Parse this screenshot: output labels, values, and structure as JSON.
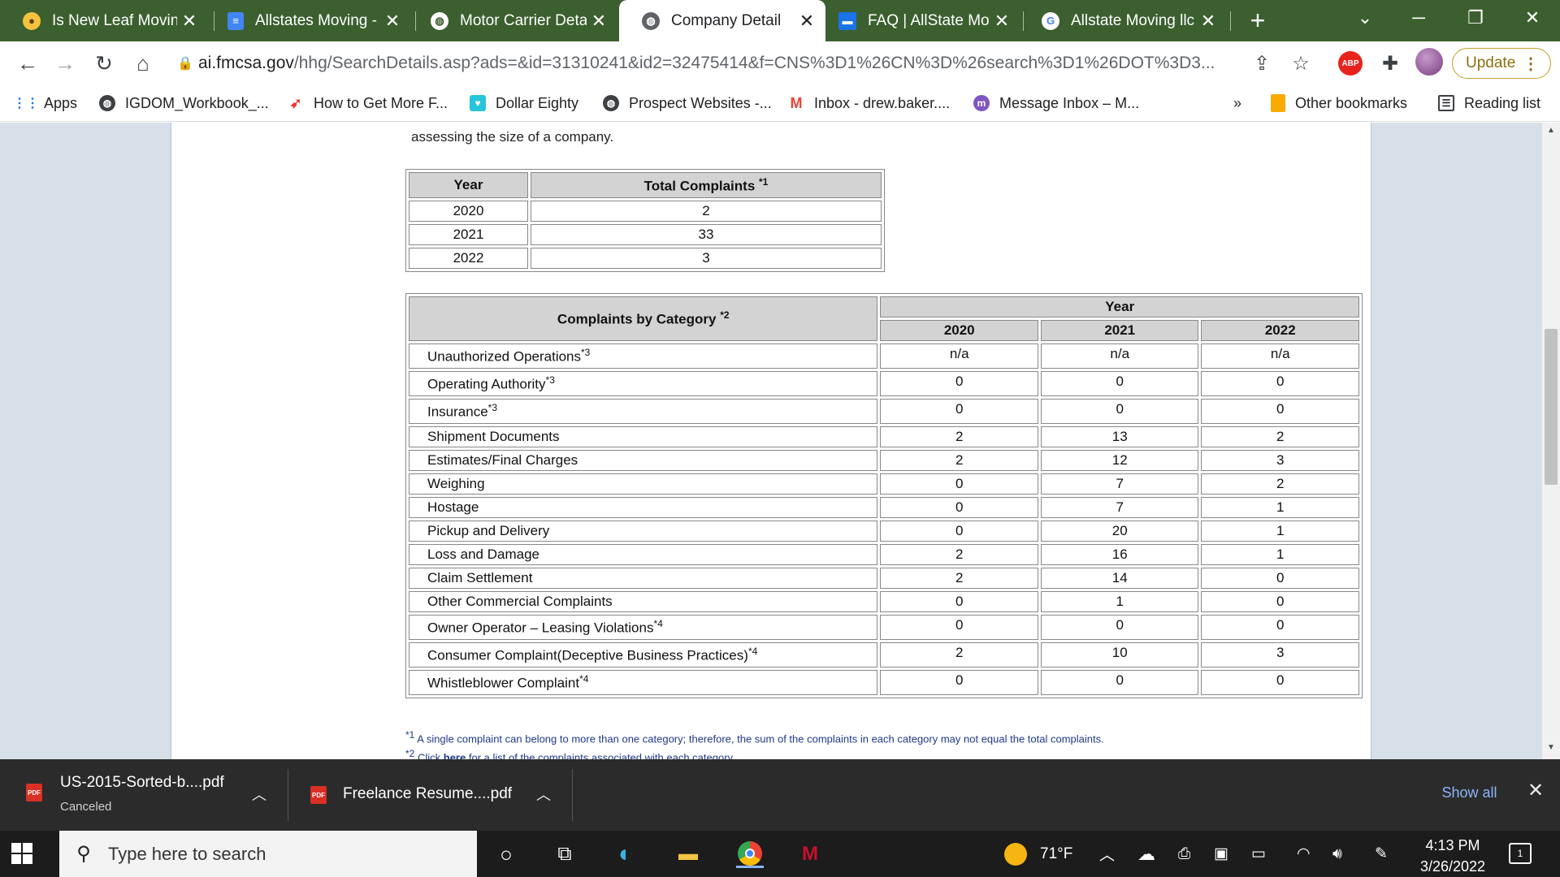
{
  "tabs": [
    {
      "label": "Is New Leaf Moving",
      "icon": "profile-favicon-icon",
      "color": "#f6c23e",
      "active": false
    },
    {
      "label": "Allstates Moving -",
      "icon": "google-docs-icon",
      "color": "#4285f4",
      "active": false
    },
    {
      "label": "Motor Carrier Detai",
      "icon": "globe-icon",
      "color": "#ffffff",
      "active": false
    },
    {
      "label": "Company Detail",
      "icon": "globe-icon",
      "color": "#5f6368",
      "active": true
    },
    {
      "label": "FAQ | AllState Movi",
      "icon": "allstate-favicon-icon",
      "color": "#1a73e8",
      "active": false
    },
    {
      "label": "Allstate Moving llc",
      "icon": "google-icon",
      "color": "#ffffff",
      "active": false
    }
  ],
  "toolbar": {
    "url_host": "ai.fmcsa.gov",
    "url_path": "/hhg/SearchDetails.asp?ads=&id=31310241&id2=32475414&f=CNS%3D1%26CN%3D%26search%3D1%26DOT%3D3...",
    "abp_label": "ABP",
    "update_label": "Update"
  },
  "bookmarks": [
    {
      "label": "Apps",
      "icon": "apps-grid-icon"
    },
    {
      "label": "IGDOM_Workbook_...",
      "icon": "globe-icon"
    },
    {
      "label": "How to Get More F...",
      "icon": "rocket-icon"
    },
    {
      "label": "Dollar Eighty",
      "icon": "heart-icon"
    },
    {
      "label": "Prospect Websites -...",
      "icon": "globe-icon"
    },
    {
      "label": "Inbox - drew.baker....",
      "icon": "gmail-icon"
    },
    {
      "label": "Message Inbox – M...",
      "icon": "messenger-icon"
    }
  ],
  "bookmarks_overflow": "»",
  "other_bookmarks": "Other bookmarks",
  "reading_list": "Reading list",
  "page": {
    "intro_text": "assessing the size of a company.",
    "totals_table": {
      "headers": {
        "year": "Year",
        "total": "Total Complaints",
        "total_note": "*1"
      },
      "rows": [
        {
          "year": "2020",
          "total": "2"
        },
        {
          "year": "2021",
          "total": "33"
        },
        {
          "year": "2022",
          "total": "3"
        }
      ]
    },
    "category_table": {
      "header_label": "Complaints by Category",
      "header_note": "*2",
      "year_header": "Year",
      "years": [
        "2020",
        "2021",
        "2022"
      ],
      "rows": [
        {
          "category": "Unauthorized Operations",
          "note": "*3",
          "values": [
            "n/a",
            "n/a",
            "n/a"
          ]
        },
        {
          "category": "Operating Authority",
          "note": "*3",
          "values": [
            "0",
            "0",
            "0"
          ]
        },
        {
          "category": "Insurance",
          "note": "*3",
          "values": [
            "0",
            "0",
            "0"
          ]
        },
        {
          "category": "Shipment Documents",
          "note": "",
          "values": [
            "2",
            "13",
            "2"
          ]
        },
        {
          "category": "Estimates/Final Charges",
          "note": "",
          "values": [
            "2",
            "12",
            "3"
          ]
        },
        {
          "category": "Weighing",
          "note": "",
          "values": [
            "0",
            "7",
            "2"
          ]
        },
        {
          "category": "Hostage",
          "note": "",
          "values": [
            "0",
            "7",
            "1"
          ]
        },
        {
          "category": "Pickup and Delivery",
          "note": "",
          "values": [
            "0",
            "20",
            "1"
          ]
        },
        {
          "category": "Loss and Damage",
          "note": "",
          "values": [
            "2",
            "16",
            "1"
          ]
        },
        {
          "category": "Claim Settlement",
          "note": "",
          "values": [
            "2",
            "14",
            "0"
          ]
        },
        {
          "category": "Other Commercial Complaints",
          "note": "",
          "values": [
            "0",
            "1",
            "0"
          ]
        },
        {
          "category": "Owner Operator – Leasing Violations",
          "note": "*4",
          "values": [
            "0",
            "0",
            "0"
          ]
        },
        {
          "category": "Consumer Complaint(Deceptive Business Practices)",
          "note": "*4",
          "values": [
            "2",
            "10",
            "3"
          ]
        },
        {
          "category": "Whistleblower Complaint",
          "note": "*4",
          "values": [
            "0",
            "0",
            "0"
          ]
        }
      ]
    },
    "footnotes": {
      "fn1_mark": "*1",
      "fn1_text": "A single complaint can belong to more than one category; therefore, the sum of the complaints in each category may not equal the total complaints.",
      "fn2_mark": "*2",
      "fn2_pre": "Click",
      "fn2_link": "here",
      "fn2_post": "for a list of the complaints associated with each category."
    }
  },
  "downloads": [
    {
      "name": "US-2015-Sorted-b....pdf",
      "status": "Canceled"
    },
    {
      "name": "Freelance Resume....pdf",
      "status": ""
    }
  ],
  "downloads_show_all": "Show all",
  "taskbar": {
    "search_placeholder": "Type here to search",
    "weather": "71°F",
    "time": "4:13 PM",
    "date": "3/26/2022",
    "notification_count": "1"
  }
}
